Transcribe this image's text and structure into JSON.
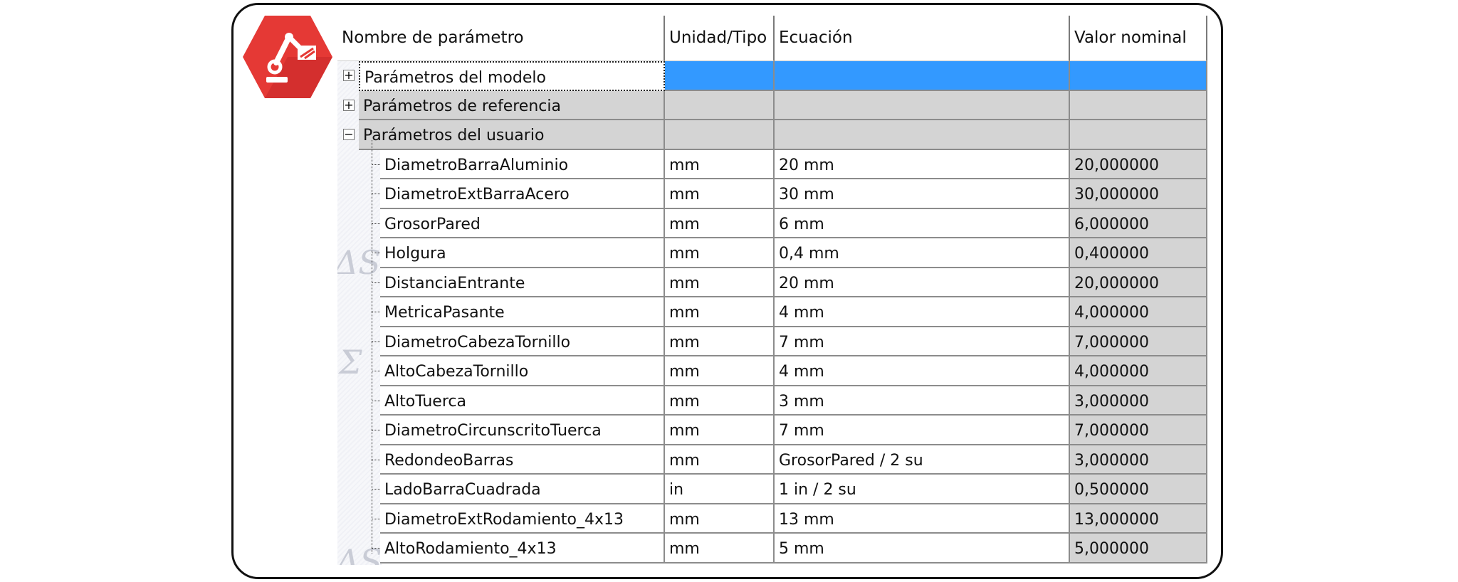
{
  "columns": {
    "name": "Nombre de parámetro",
    "unit": "Unidad/Tipo",
    "equation": "Ecuación",
    "nominal": "Valor nominal"
  },
  "groups": [
    {
      "label": "Parámetros del modelo",
      "expander": "+",
      "selected": true
    },
    {
      "label": "Parámetros de referencia",
      "expander": "+",
      "selected": false
    },
    {
      "label": "Parámetros del usuario",
      "expander": "−",
      "selected": false
    }
  ],
  "params": [
    {
      "name": "DiametroBarraAluminio",
      "unit": "mm",
      "equation": "20 mm",
      "value": "20,000000"
    },
    {
      "name": "DiametroExtBarraAcero",
      "unit": "mm",
      "equation": "30 mm",
      "value": "30,000000"
    },
    {
      "name": "GrosorPared",
      "unit": "mm",
      "equation": "6 mm",
      "value": "6,000000"
    },
    {
      "name": "Holgura",
      "unit": "mm",
      "equation": "0,4 mm",
      "value": "0,400000"
    },
    {
      "name": "DistanciaEntrante",
      "unit": "mm",
      "equation": "20 mm",
      "value": "20,000000"
    },
    {
      "name": "MetricaPasante",
      "unit": "mm",
      "equation": "4 mm",
      "value": "4,000000"
    },
    {
      "name": "DiametroCabezaTornillo",
      "unit": "mm",
      "equation": "7 mm",
      "value": "7,000000"
    },
    {
      "name": "AltoCabezaTornillo",
      "unit": "mm",
      "equation": "4 mm",
      "value": "4,000000"
    },
    {
      "name": "AltoTuerca",
      "unit": "mm",
      "equation": "3 mm",
      "value": "3,000000"
    },
    {
      "name": "DiametroCircunscritoTuerca",
      "unit": "mm",
      "equation": "7 mm",
      "value": "7,000000"
    },
    {
      "name": "RedondeoBarras",
      "unit": "mm",
      "equation": "GrosorPared / 2 su",
      "value": "3,000000"
    },
    {
      "name": "LadoBarraCuadrada",
      "unit": "in",
      "equation": "1 in / 2 su",
      "value": "0,500000"
    },
    {
      "name": "DiametroExtRodamiento_4x13",
      "unit": "mm",
      "equation": "13 mm",
      "value": "13,000000"
    },
    {
      "name": "AltoRodamiento_4x13",
      "unit": "mm",
      "equation": "5 mm",
      "value": "5,000000"
    }
  ],
  "colors": {
    "logo_red": "#e53935",
    "logo_red_dark": "#c62828",
    "selection_blue": "#3399ff",
    "group_gray": "#d4d4d4"
  },
  "icons": {
    "logo": "robot-arm-icon"
  }
}
